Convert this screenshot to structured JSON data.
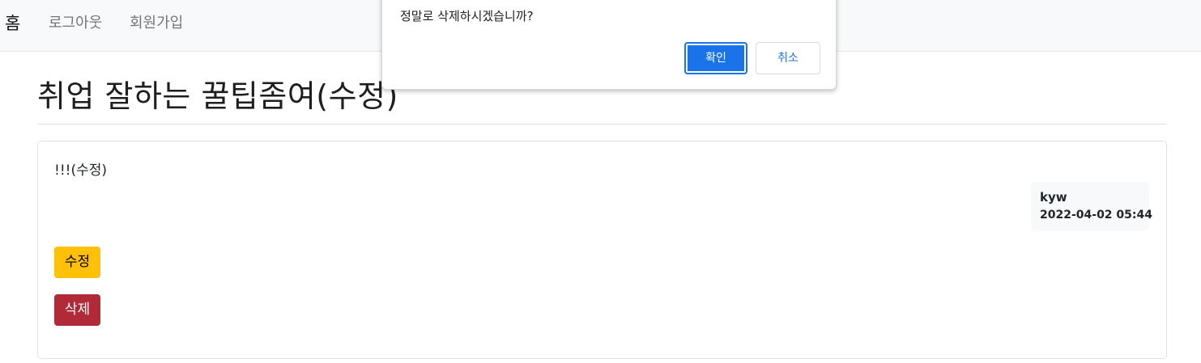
{
  "navbar": {
    "brand": "홈",
    "links": [
      "로그아웃",
      "회원가입"
    ]
  },
  "post": {
    "title": "취업 잘하는 꿀팁좀여(수정)",
    "content": "!!!(수정)",
    "author": "kyw",
    "date": "2022-04-02 05:44",
    "edit_label": "수정",
    "delete_label": "삭제"
  },
  "confirm_dialog": {
    "message": "정말로 삭제하시겠습니까?",
    "ok_label": "확인",
    "cancel_label": "취소"
  },
  "colors": {
    "edit_button": "#ffc107",
    "delete_button": "#b02a37",
    "dialog_primary": "#1a73e8"
  }
}
